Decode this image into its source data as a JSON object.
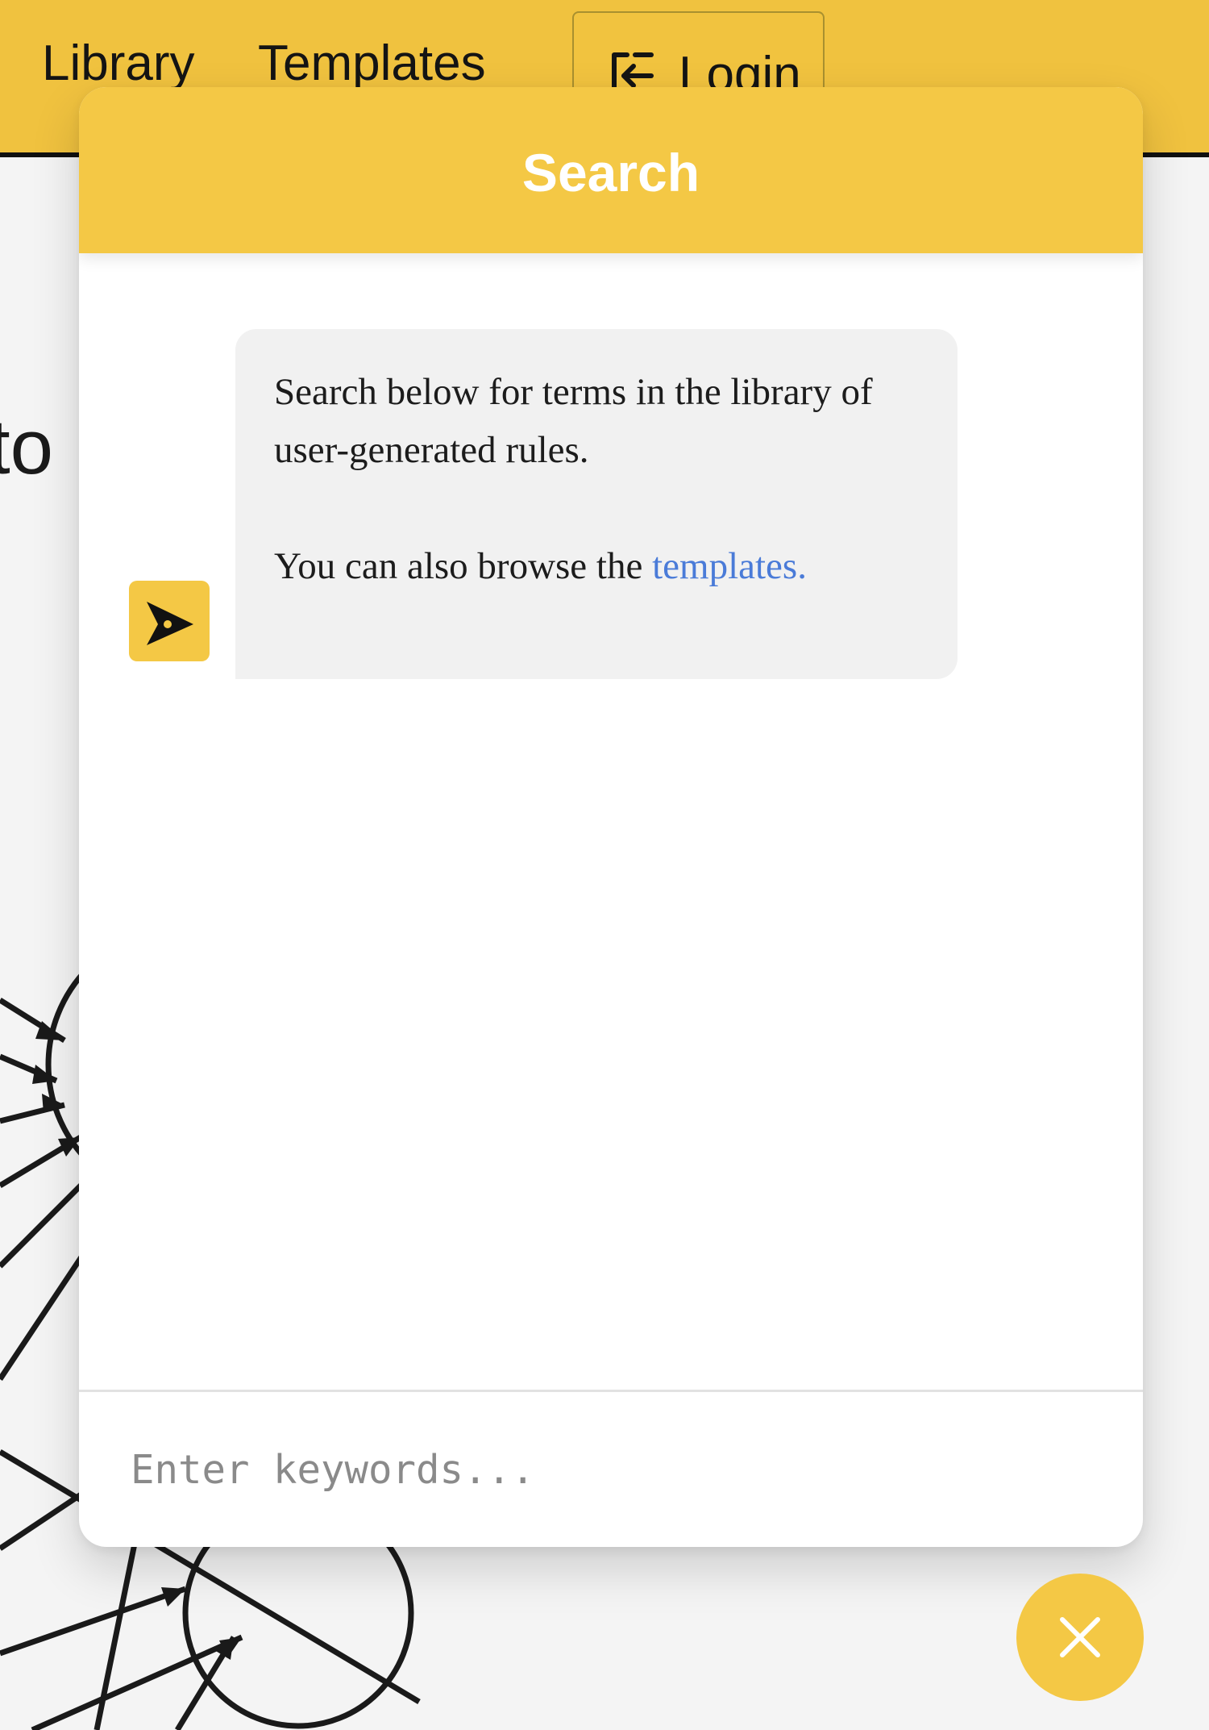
{
  "navbar": {
    "links": [
      {
        "label": "Library"
      },
      {
        "label": "Templates"
      }
    ],
    "login": {
      "label": "Login",
      "icon": "login-icon"
    }
  },
  "background": {
    "partial_heading": "to"
  },
  "search_panel": {
    "title": "Search",
    "avatar_icon": "arrow-pointer-icon",
    "message": {
      "line1": "Search below for terms in the library of user-generated rules.",
      "line2_prefix": "You can also browse the ",
      "line2_link": "templates."
    },
    "input": {
      "placeholder": "Enter keywords...",
      "value": ""
    }
  },
  "close_button": {
    "icon": "close-icon"
  },
  "colors": {
    "brand_yellow": "#f4c845",
    "link_blue": "#4a7bd8",
    "bubble_gray": "#f1f1f1"
  }
}
